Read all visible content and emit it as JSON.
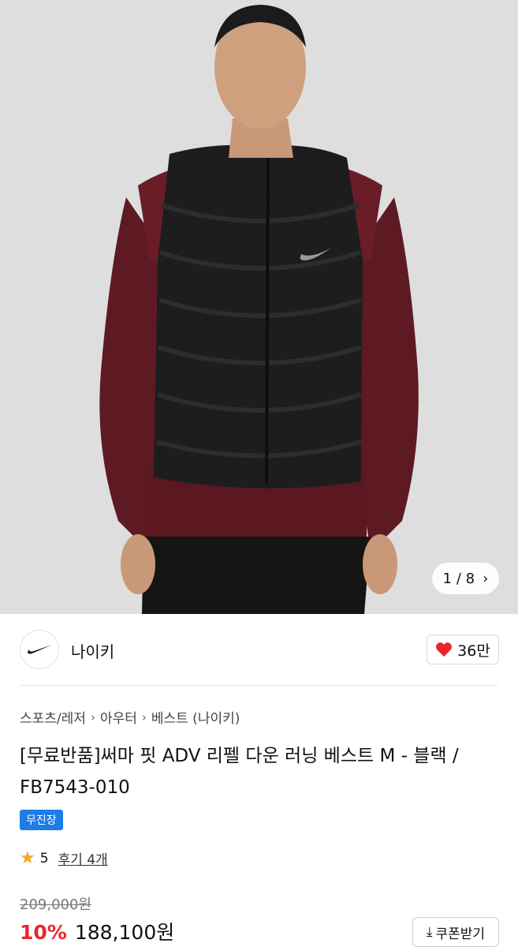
{
  "gallery": {
    "current": "1",
    "total": "8",
    "separator": "/"
  },
  "brand": {
    "name": "나이키",
    "likes": "36만"
  },
  "breadcrumb": [
    "스포츠/레저",
    "아우터",
    "베스트 (나이키)"
  ],
  "product": {
    "title": "[무료반품]써마 핏 ADV 리펠 다운 러닝 베스트 M - 블랙 / FB7543-010",
    "badge": "무진장",
    "rating": "5",
    "reviews": "후기 4개",
    "original_price": "209,000원",
    "discount": "10%",
    "sale_price": "188,100원",
    "coupon_label": "쿠폰받기"
  },
  "icons": {
    "chevron": "chevron-right-icon",
    "heart": "heart-icon",
    "star": "star-icon",
    "download": "download-icon",
    "logo": "nike-swoosh-logo"
  },
  "colors": {
    "accent_red": "#e8262c",
    "badge_blue": "#1c7ce8",
    "star": "#f5a623",
    "heart": "#e8262c"
  }
}
